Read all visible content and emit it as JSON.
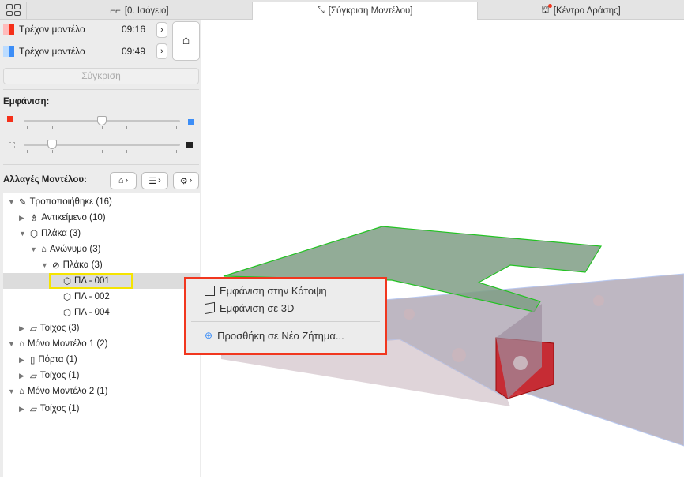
{
  "tabs": [
    {
      "label": "[0. Ισόγειο]",
      "icon": "floor-plan-icon"
    },
    {
      "label": "[Σύγκριση Μοντέλου]",
      "icon": "compare-icon",
      "active": true
    },
    {
      "label": "[Κέντρο Δράσης]",
      "icon": "lighthouse-icon"
    }
  ],
  "models": [
    {
      "label": "Τρέχον μοντέλο",
      "time": "09:16",
      "color": "#f5301a"
    },
    {
      "label": "Τρέχον μοντέλο",
      "time": "09:49",
      "color": "#3d8ef7"
    }
  ],
  "compare_button": "Σύγκριση",
  "display_label": "Εμφάνιση:",
  "sliders": {
    "overlay": 0.5,
    "transparency": 0.17
  },
  "changes_label": "Αλλαγές Μοντέλου:",
  "tree": [
    {
      "label": "Τροποποιήθηκε (16)",
      "expanded": true
    },
    {
      "label": "Αντικείμενο (10)",
      "expanded": false
    },
    {
      "label": "Πλάκα (3)",
      "expanded": true
    },
    {
      "label": "Ανώνυμο (3)",
      "expanded": true
    },
    {
      "label": "Πλάκα (3)",
      "expanded": true
    },
    {
      "label": "ΠΛ - 001",
      "selected": true
    },
    {
      "label": "ΠΛ - 002"
    },
    {
      "label": "ΠΛ - 004"
    },
    {
      "label": "Τοίχος (3)",
      "expanded": false
    },
    {
      "label": "Μόνο Μοντέλο 1 (2)",
      "expanded": true
    },
    {
      "label": "Πόρτα (1)",
      "expanded": false
    },
    {
      "label": "Τοίχος (1)",
      "expanded": false
    },
    {
      "label": "Μόνο Μοντέλο 2 (1)",
      "expanded": true
    },
    {
      "label": "Τοίχος (1)",
      "expanded": false
    }
  ],
  "context_menu": [
    "Εμφάνιση στην Κάτοψη",
    "Εμφάνιση σε 3D",
    "Προσθήκη σε Νέο Ζήτημα..."
  ]
}
